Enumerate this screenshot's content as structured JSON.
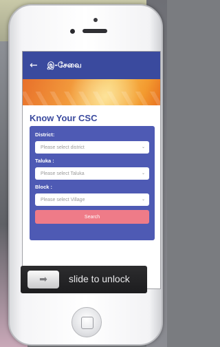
{
  "app": {
    "title": "இ-சேவை",
    "back_icon": "arrow-left-icon"
  },
  "page": {
    "heading": "Know Your CSC"
  },
  "form": {
    "district_label": "District:",
    "district_placeholder": "Please select district",
    "taluka_label": "Taluka :",
    "taluka_placeholder": "Please select Taluka",
    "block_label": "Block :",
    "block_placeholder": "Please select Village",
    "search_label": "Search"
  },
  "lockscreen": {
    "slide_text": "slide to unlock",
    "knob_icon": "arrow-right-icon"
  },
  "colors": {
    "appbar": "#3a4a9e",
    "card": "#4e5ab4",
    "search_button": "#ef7b88",
    "heading": "#3a4a9e"
  }
}
